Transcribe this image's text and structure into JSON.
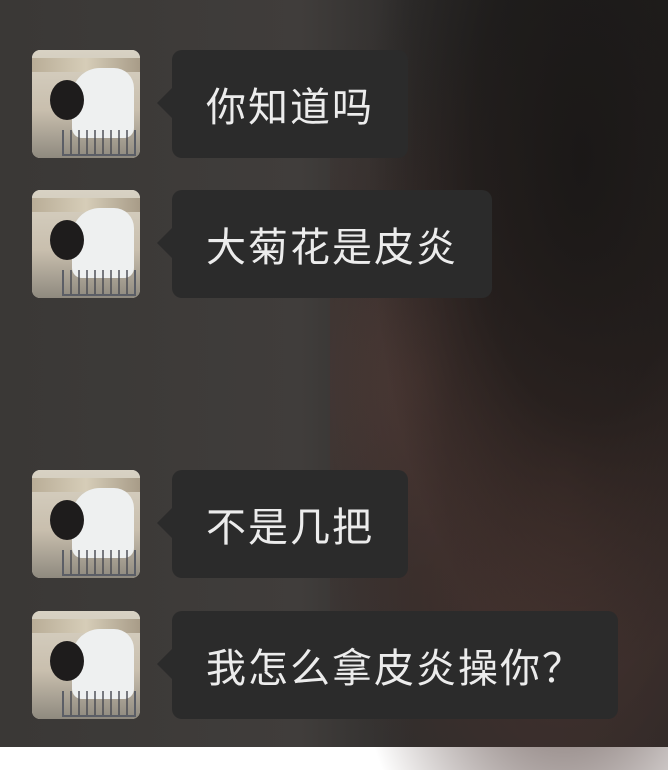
{
  "conversation": {
    "messages": [
      {
        "text": "你知道吗",
        "avatar_icon": "person-at-cart-avatar"
      },
      {
        "text": "大菊花是皮炎",
        "avatar_icon": "person-at-cart-avatar"
      },
      {
        "text": "不是几把",
        "avatar_icon": "person-at-cart-avatar"
      },
      {
        "text": "我怎么拿皮炎操你？",
        "avatar_icon": "person-at-cart-avatar"
      }
    ]
  },
  "colors": {
    "bubble_background": "#2b2b2b",
    "bubble_text": "#ececec",
    "page_background": "#3a3836"
  }
}
